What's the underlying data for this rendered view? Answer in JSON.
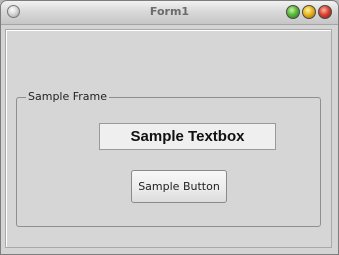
{
  "window": {
    "title": "Form1",
    "controls": {
      "minimize_icon": "green-circle-icon",
      "maximize_icon": "yellow-circle-icon",
      "close_icon": "red-circle-icon"
    }
  },
  "frame": {
    "label": "Sample Frame",
    "textbox": {
      "value": "Sample Textbox"
    },
    "button": {
      "label": "Sample Button"
    }
  },
  "colors": {
    "background": "#d4d4d4",
    "minimize": "#59b83a",
    "maximize": "#e8b51f",
    "close": "#d9432f"
  }
}
